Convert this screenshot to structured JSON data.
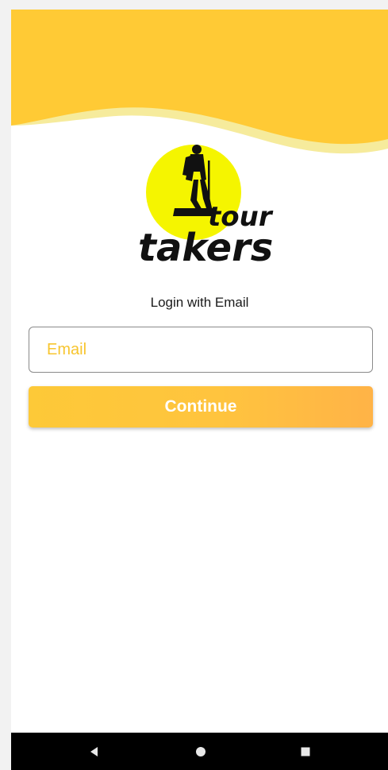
{
  "app": {
    "logo_text": "tour takers"
  },
  "login": {
    "title": "Login with Email",
    "email_placeholder": "Email",
    "email_value": "",
    "continue_label": "Continue"
  },
  "colors": {
    "header_yellow": "#ffca35",
    "wave_light": "#f6eb9c",
    "logo_sun": "#f5f500",
    "placeholder": "#f7c52f",
    "button_start": "#fdc938",
    "button_end": "#ffb347"
  },
  "navbar": {
    "back_icon": "back-triangle-icon",
    "home_icon": "home-circle-icon",
    "recents_icon": "recents-square-icon"
  }
}
